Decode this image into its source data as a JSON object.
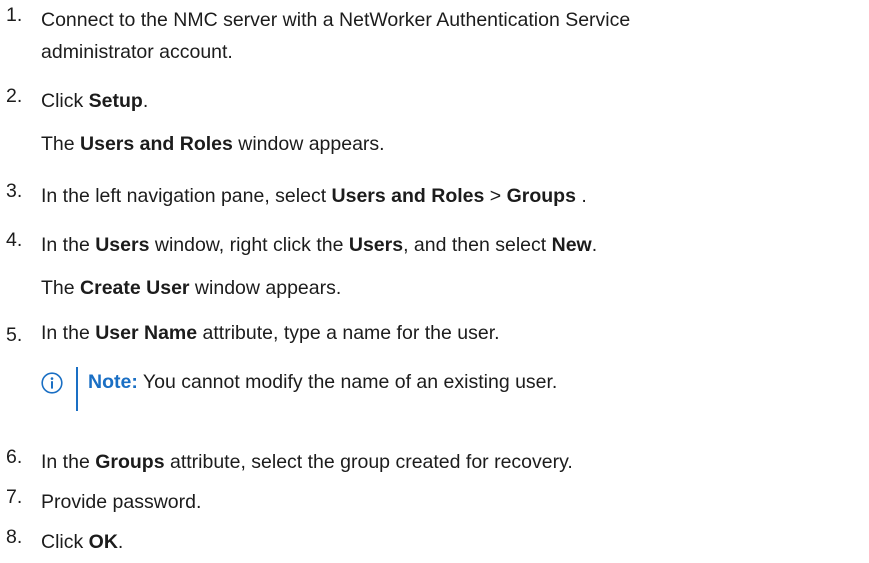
{
  "steps": [
    {
      "num": "1.",
      "line1": "Connect to the NMC server with a NetWorker Authentication Service",
      "line2": "administrator account."
    },
    {
      "num": "2.",
      "pre": "Click ",
      "b1": "Setup",
      "post": "."
    },
    {
      "pre": "The ",
      "b1": "Users and Roles",
      "post": " window appears."
    },
    {
      "num": "3.",
      "pre": "In the left navigation pane, select ",
      "b1": "Users and Roles",
      "mid": " > ",
      "b2": "Groups",
      "post": " ."
    },
    {
      "num": "4.",
      "pre": "In the ",
      "b1": "Users",
      "mid1": " window, right click the ",
      "b2": "Users",
      "mid2": ", and then select ",
      "b3": "New",
      "post": "."
    },
    {
      "pre": "The ",
      "b1": "Create User",
      "post": " window appears."
    },
    {
      "num": "5.",
      "pre": "In the ",
      "b1": "User Name",
      "post": " attribute, type a name for the user."
    },
    {
      "num": "6.",
      "pre": "In the ",
      "b1": "Groups",
      "post": " attribute, select the group created for recovery."
    },
    {
      "num": "7.",
      "text": "Provide password."
    },
    {
      "num": "8.",
      "pre": "Click ",
      "b1": "OK",
      "post": "."
    }
  ],
  "note": {
    "icon": "info-icon",
    "label": "Note:",
    "text": " You cannot modify the name of an existing user."
  },
  "colors": {
    "text": "#1c1c1c",
    "accent": "#1a6fc4"
  }
}
